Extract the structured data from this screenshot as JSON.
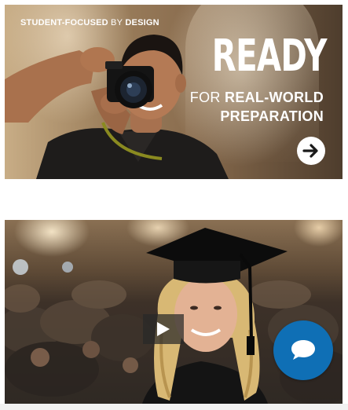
{
  "promo": {
    "kicker_bold": "STUDENT-FOCUSED",
    "kicker_light": "BY",
    "kicker_bold_2": "DESIGN",
    "headline": "READY",
    "sub_light": "FOR",
    "sub_bold_1": "REAL-WORLD",
    "sub_bold_2": "PREPARATION",
    "arrow_icon": "arrow-right-circle-icon"
  },
  "video": {
    "play_icon": "play-icon"
  },
  "chat": {
    "icon": "speech-bubble-icon",
    "color": "#0f6fb5"
  }
}
